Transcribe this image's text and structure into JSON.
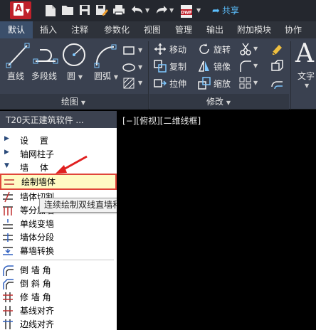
{
  "app": {
    "logo_letter": "A"
  },
  "quick_access": {
    "icons": [
      "new-file-icon",
      "open-folder-icon",
      "save-icon",
      "save-as-icon",
      "print-icon",
      "undo-icon",
      "redo-icon",
      "dwf-export-icon"
    ],
    "dwf_label": "DWF",
    "share_label": "共享"
  },
  "tabs": [
    "默认",
    "插入",
    "注释",
    "参数化",
    "视图",
    "管理",
    "输出",
    "附加模块",
    "协作"
  ],
  "active_tab": "默认",
  "ribbon": {
    "draw": {
      "title": "绘图",
      "line": "直线",
      "polyline": "多段线",
      "circle": "圆",
      "arc": "圆弧"
    },
    "modify": {
      "title": "修改",
      "move": "移动",
      "rotate": "旋转",
      "copy": "复制",
      "mirror": "镜像",
      "stretch": "拉伸",
      "scale": "缩放"
    },
    "text_label": "文字",
    "text_glyph": "A"
  },
  "panel": {
    "title": "T20天正建筑软件 ...",
    "tree": [
      {
        "label": "设　 置",
        "expanded": false
      },
      {
        "label": "轴网柱子",
        "expanded": false
      },
      {
        "label": "墙　 体",
        "expanded": true
      }
    ],
    "commands": [
      {
        "label": "绘制墙体",
        "selected": true
      },
      {
        "label": "墙体切割"
      },
      {
        "label": "等分加墙"
      },
      {
        "label": "单线变墙"
      },
      {
        "label": "墙体分段"
      },
      {
        "label": "幕墙转换"
      },
      {
        "label": "倒 墙 角"
      },
      {
        "label": "倒 斜 角"
      },
      {
        "label": "修 墙 角"
      },
      {
        "label": "基线对齐"
      },
      {
        "label": "边线对齐"
      }
    ]
  },
  "tooltip": "连续绘制双线直墙和弧墙：HZQT",
  "viewport": {
    "label": "[−][俯视][二维线框]"
  },
  "colors": {
    "selection_border": "#e0463a",
    "selection_fill": "#fffbc4",
    "arrow": "#e02020",
    "accent_share": "#5cc0ff"
  }
}
